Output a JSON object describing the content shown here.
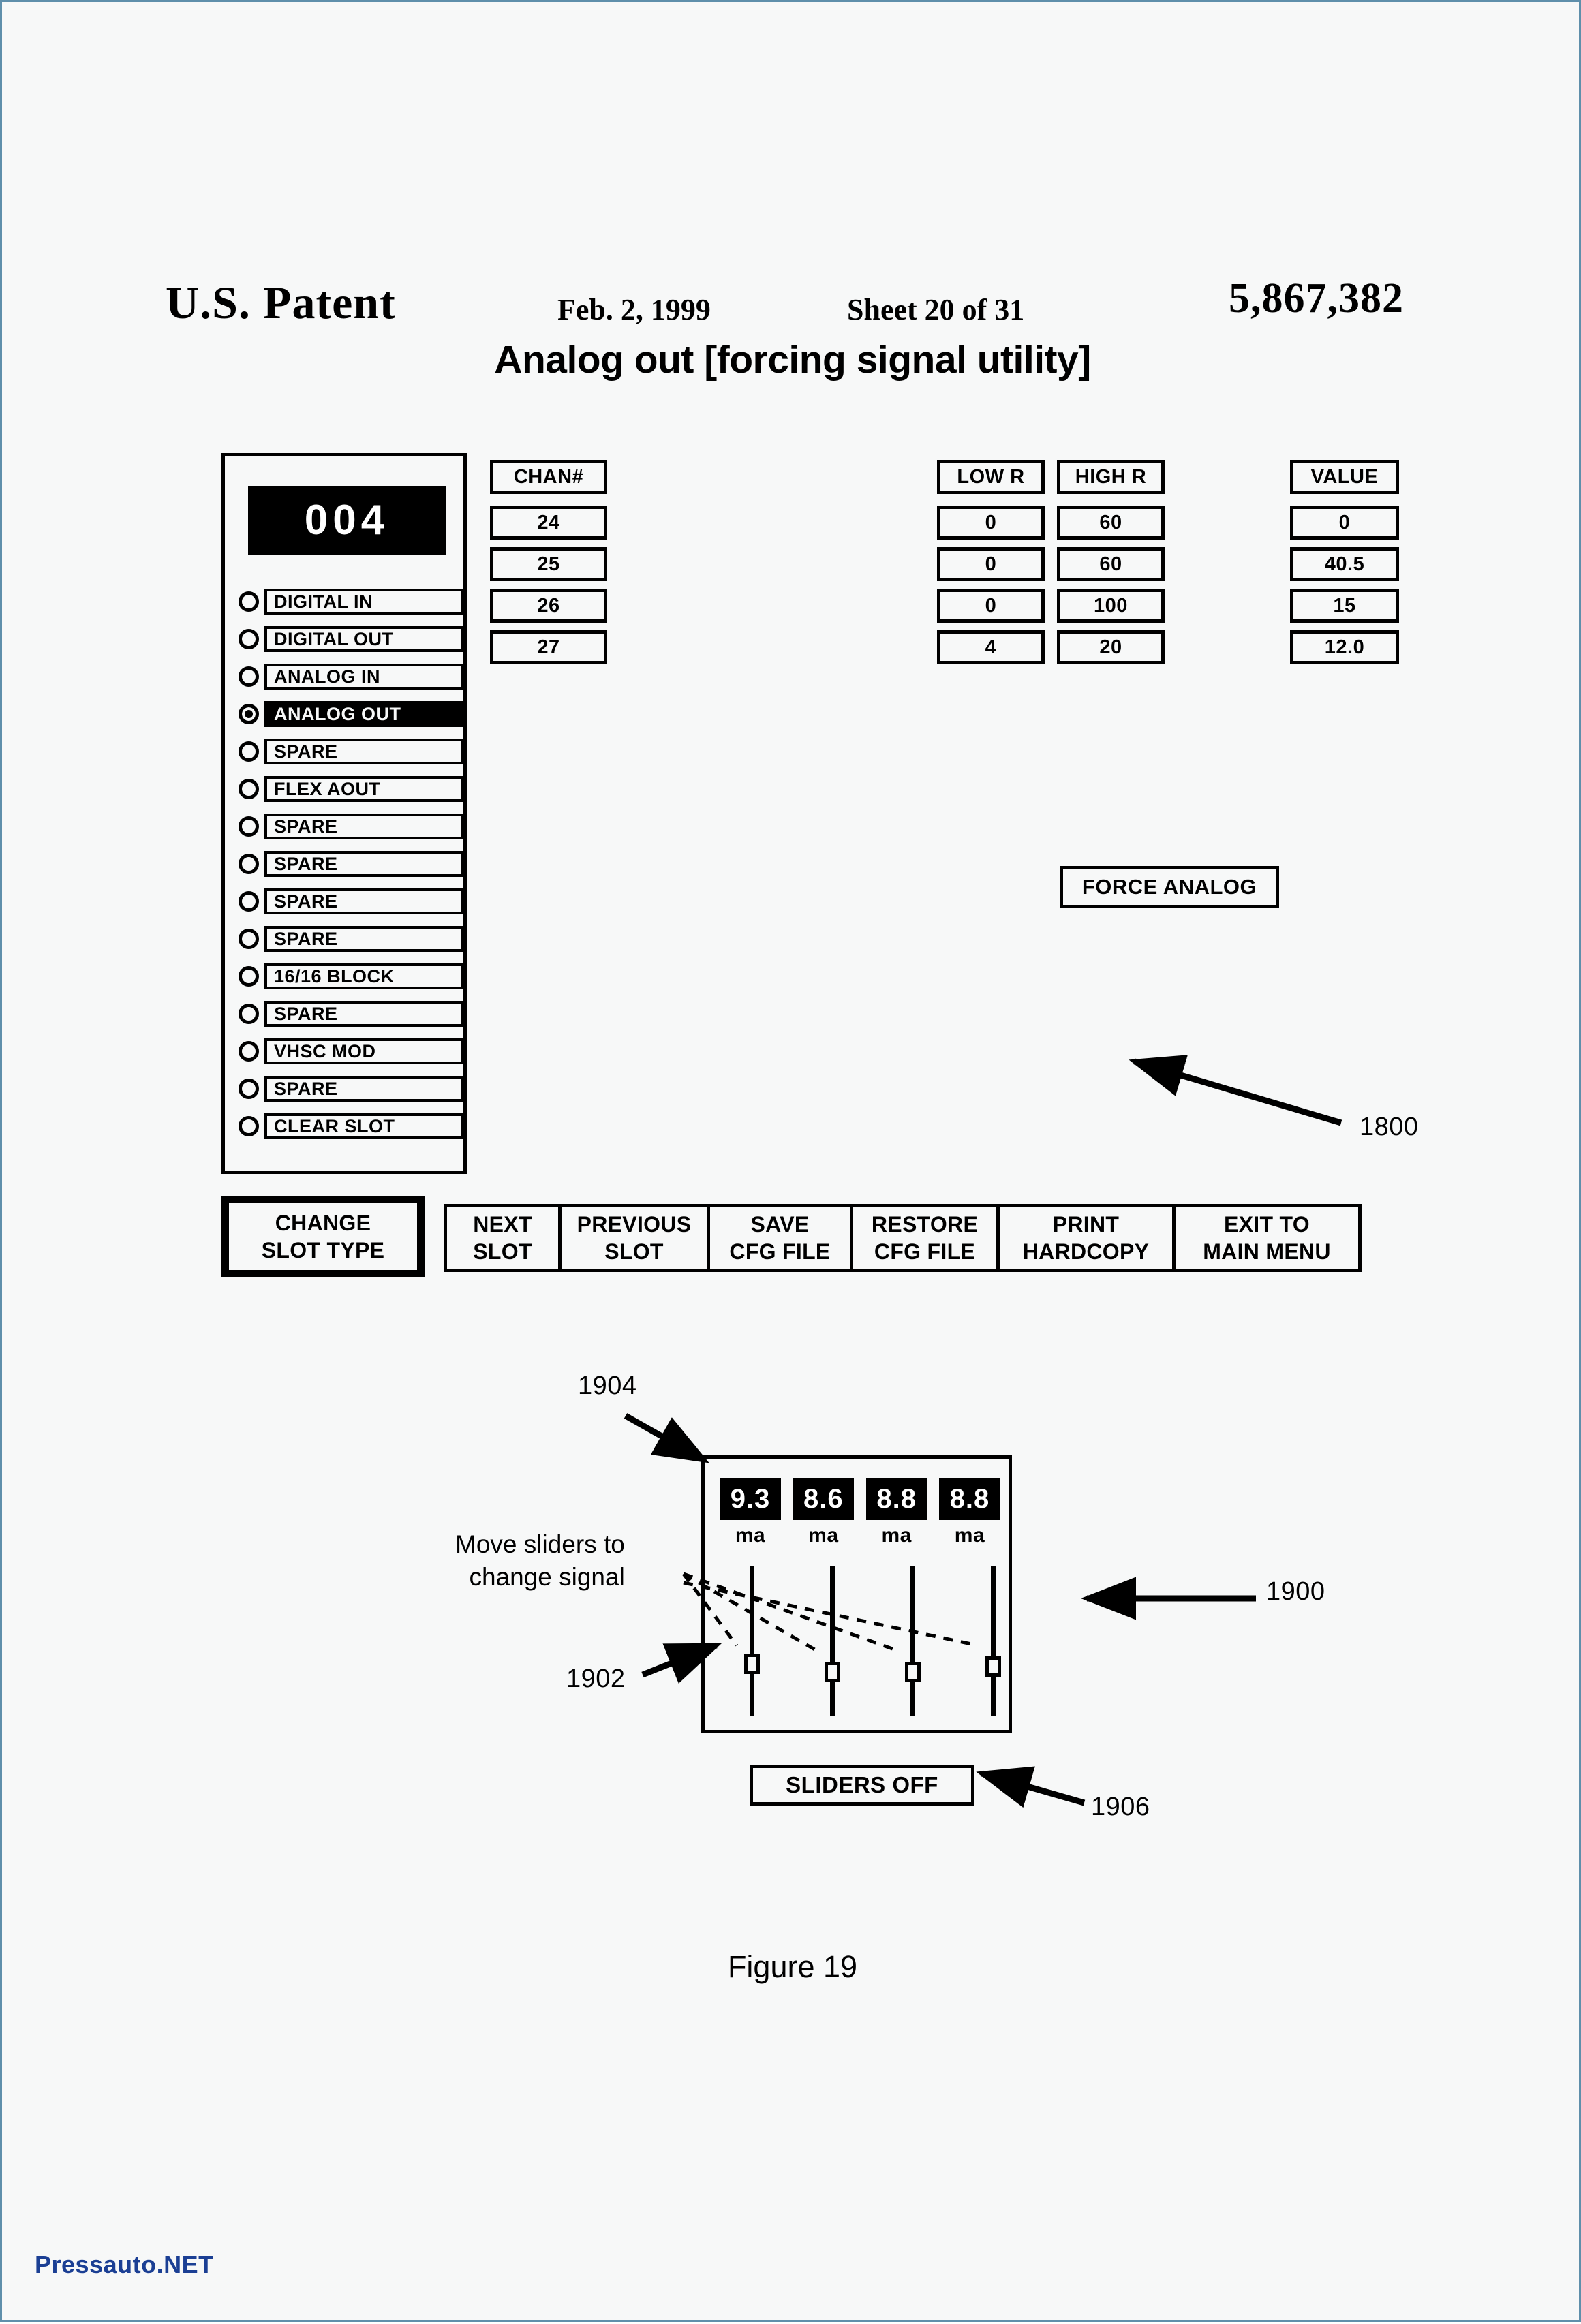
{
  "page": {
    "watermark": "Pressauto.NET",
    "border_color": "#5f8fab"
  },
  "header": {
    "office": "U.S. Patent",
    "date": "Feb. 2, 1999",
    "sheet": "Sheet 20 of 31",
    "patent_number": "5,867,382"
  },
  "figure": {
    "title": "Analog out [forcing signal utility]",
    "caption": "Figure 19"
  },
  "slot_panel": {
    "display_value": "004",
    "items": [
      {
        "label": "DIGITAL IN",
        "selected": false
      },
      {
        "label": "DIGITAL OUT",
        "selected": false
      },
      {
        "label": "ANALOG IN",
        "selected": false
      },
      {
        "label": "ANALOG OUT",
        "selected": true
      },
      {
        "label": "SPARE",
        "selected": false
      },
      {
        "label": "FLEX AOUT",
        "selected": false
      },
      {
        "label": "SPARE",
        "selected": false
      },
      {
        "label": "SPARE",
        "selected": false
      },
      {
        "label": "SPARE",
        "selected": false
      },
      {
        "label": "SPARE",
        "selected": false
      },
      {
        "label": "16/16 BLOCK",
        "selected": false
      },
      {
        "label": "SPARE",
        "selected": false
      },
      {
        "label": "VHSC MOD",
        "selected": false
      },
      {
        "label": "SPARE",
        "selected": false
      },
      {
        "label": "CLEAR SLOT",
        "selected": false
      }
    ]
  },
  "table": {
    "columns": [
      {
        "header": "CHAN#",
        "values": [
          "24",
          "25",
          "26",
          "27"
        ]
      },
      {
        "header": "LOW R",
        "values": [
          "0",
          "0",
          "0",
          "4"
        ]
      },
      {
        "header": "HIGH R",
        "values": [
          "60",
          "60",
          "100",
          "20"
        ]
      },
      {
        "header": "VALUE",
        "values": [
          "0",
          "40.5",
          "15",
          "12.0"
        ]
      }
    ]
  },
  "force_analog_button": "FORCE ANALOG",
  "buttons": {
    "change_slot_type": [
      "CHANGE",
      "SLOT TYPE"
    ],
    "bar": [
      {
        "lines": [
          "NEXT",
          "SLOT"
        ]
      },
      {
        "lines": [
          "PREVIOUS",
          "SLOT"
        ]
      },
      {
        "lines": [
          "SAVE",
          "CFG FILE"
        ]
      },
      {
        "lines": [
          "RESTORE",
          "CFG FILE"
        ]
      },
      {
        "lines": [
          "PRINT",
          "HARDCOPY"
        ]
      },
      {
        "lines": [
          "EXIT TO",
          "MAIN MENU"
        ]
      }
    ]
  },
  "slider_panel": {
    "channels": [
      {
        "value": "9.3",
        "unit": "ma"
      },
      {
        "value": "8.6",
        "unit": "ma"
      },
      {
        "value": "8.8",
        "unit": "ma"
      },
      {
        "value": "8.8",
        "unit": "ma"
      }
    ],
    "sliders_off_button": "SLIDERS OFF"
  },
  "annotations": {
    "note_line1": "Move sliders to",
    "note_line2": "change signal",
    "ref_1800": "1800",
    "ref_1900": "1900",
    "ref_1902": "1902",
    "ref_1904": "1904",
    "ref_1906": "1906"
  }
}
